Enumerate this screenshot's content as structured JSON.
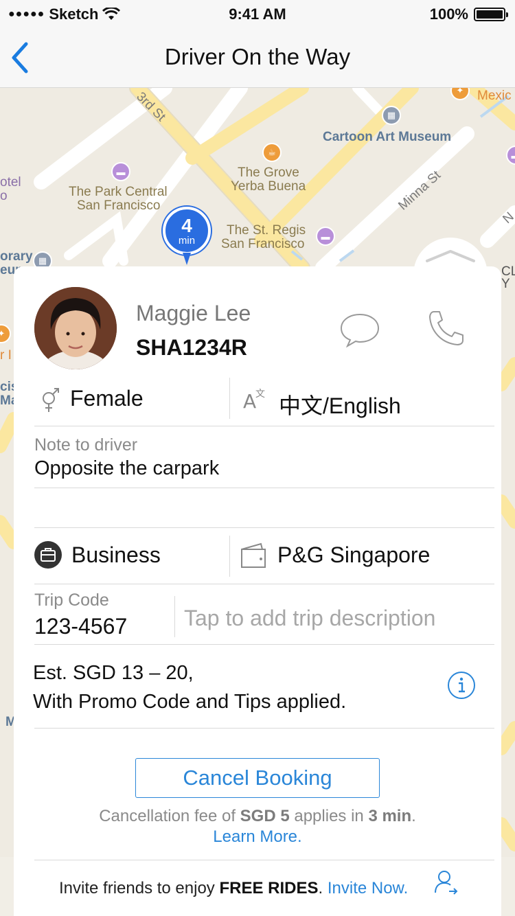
{
  "status_bar": {
    "carrier": "Sketch",
    "time": "9:41 AM",
    "battery": "100%"
  },
  "nav": {
    "title": "Driver On the Way"
  },
  "map": {
    "streets": {
      "third_st": "3rd St",
      "minna_st": "Minna St",
      "n_st": "N"
    },
    "places": {
      "mexico": "Mexic",
      "cartoon_art_museum": "Cartoon Art Museum",
      "hotel_left": "otel",
      "hotel_left_2": "o",
      "park_central_1": "The Park Central",
      "park_central_2": "San Francisco",
      "grove_1": "The Grove",
      "grove_2": "Yerba Buena",
      "st_regis_1": "The St. Regis",
      "st_regis_2": "San Francisco",
      "library_1": "orary",
      "library_2": "eum",
      "cl": "CL",
      "y": "Y",
      "edge_r": "r I",
      "edge_cis": "cis",
      "edge_ma": "Ma",
      "edge_m": "M"
    },
    "eta": {
      "value": "4",
      "unit": "min"
    }
  },
  "driver": {
    "name": "Maggie Lee",
    "plate": "SHA1234R",
    "gender": "Female",
    "languages": "中文/English"
  },
  "note": {
    "label": "Note to driver",
    "value": "Opposite the carpark"
  },
  "profile": {
    "type": "Business",
    "company": "P&G Singapore"
  },
  "trip": {
    "code_label": "Trip Code",
    "code_value": "123-4567",
    "description_placeholder": "Tap to add trip description"
  },
  "fare": {
    "line1": "Est. SGD 13 – 20,",
    "line2": "With Promo Code and Tips applied."
  },
  "cancel": {
    "button": "Cancel Booking",
    "fee_prefix": "Cancellation fee of ",
    "fee_amount": "SGD 5",
    "fee_mid": " applies in ",
    "fee_time": "3 min",
    "fee_suffix": ".",
    "learn_more": "Learn More."
  },
  "invite": {
    "prefix": "Invite friends to enjoy ",
    "bold": "FREE RIDES",
    "mid": ". ",
    "link": "Invite Now."
  },
  "colors": {
    "accent": "#2a86d8",
    "pin": "#2a6de0",
    "road": "#fbe7a0",
    "map_bg": "#efebe2"
  }
}
